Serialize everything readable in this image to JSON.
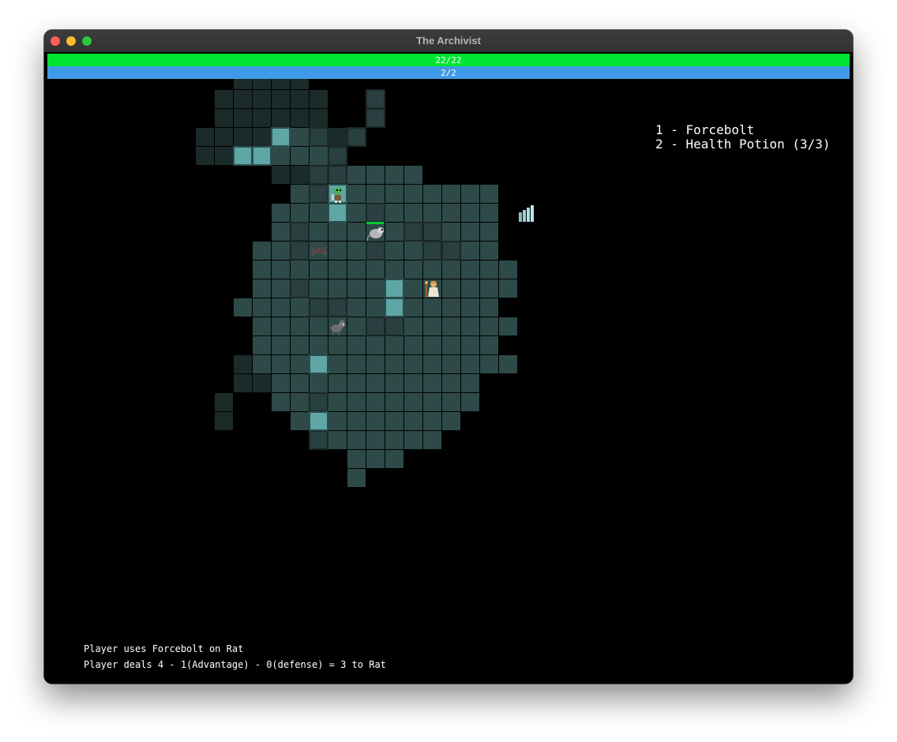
{
  "window": {
    "title": "The Archivist"
  },
  "stats": {
    "hp": {
      "current": 22,
      "max": 22,
      "label": "22/22",
      "color": "#00e532"
    },
    "mana": {
      "current": 2,
      "max": 2,
      "label": "2/2",
      "color": "#3f9be9"
    }
  },
  "hotbar": [
    {
      "key": "1",
      "label": "1 - Forcebolt"
    },
    {
      "key": "2",
      "label": "2 - Health Potion (3/3)"
    }
  ],
  "map": {
    "floor_color": "#2d4a49",
    "dim_floor_color": "#1b2b2a",
    "wall_color": "#5fa6a6",
    "entities": [
      {
        "name": "goblin",
        "icon": "goblin-icon"
      },
      {
        "name": "rat",
        "icon": "rat-icon",
        "health_fraction": 0.9
      },
      {
        "name": "spider",
        "icon": "spider-icon"
      },
      {
        "name": "player",
        "icon": "player-archivist-icon"
      },
      {
        "name": "wolf",
        "icon": "wolf-icon"
      },
      {
        "name": "stairs",
        "icon": "stairs-icon"
      }
    ]
  },
  "log": [
    "Player uses Forcebolt on Rat",
    "Player deals 4 - 1(Advantage) - 0(defense) = 3 to Rat"
  ]
}
